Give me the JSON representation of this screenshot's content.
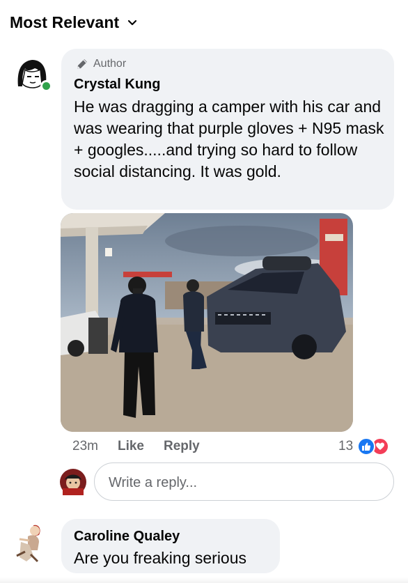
{
  "header": {
    "sort_label": "Most Relevant"
  },
  "comment": {
    "badge": "Author",
    "author": "Crystal Kung",
    "text": "He was dragging a camper with his car and was wearing that purple gloves + N95 mask + googles.....and trying so hard to follow social distancing. It was gold.",
    "time": "23m",
    "like_label": "Like",
    "reply_label": "Reply",
    "reaction_count": "13",
    "reactions": [
      "like",
      "love"
    ]
  },
  "reply_input": {
    "placeholder": "Write a reply..."
  },
  "comment2": {
    "author": "Caroline Qualey",
    "text": "Are you freaking serious"
  },
  "colors": {
    "like": "#1877f2",
    "love": "#f33e58",
    "online": "#31a24c",
    "bubble": "#f0f2f5"
  }
}
